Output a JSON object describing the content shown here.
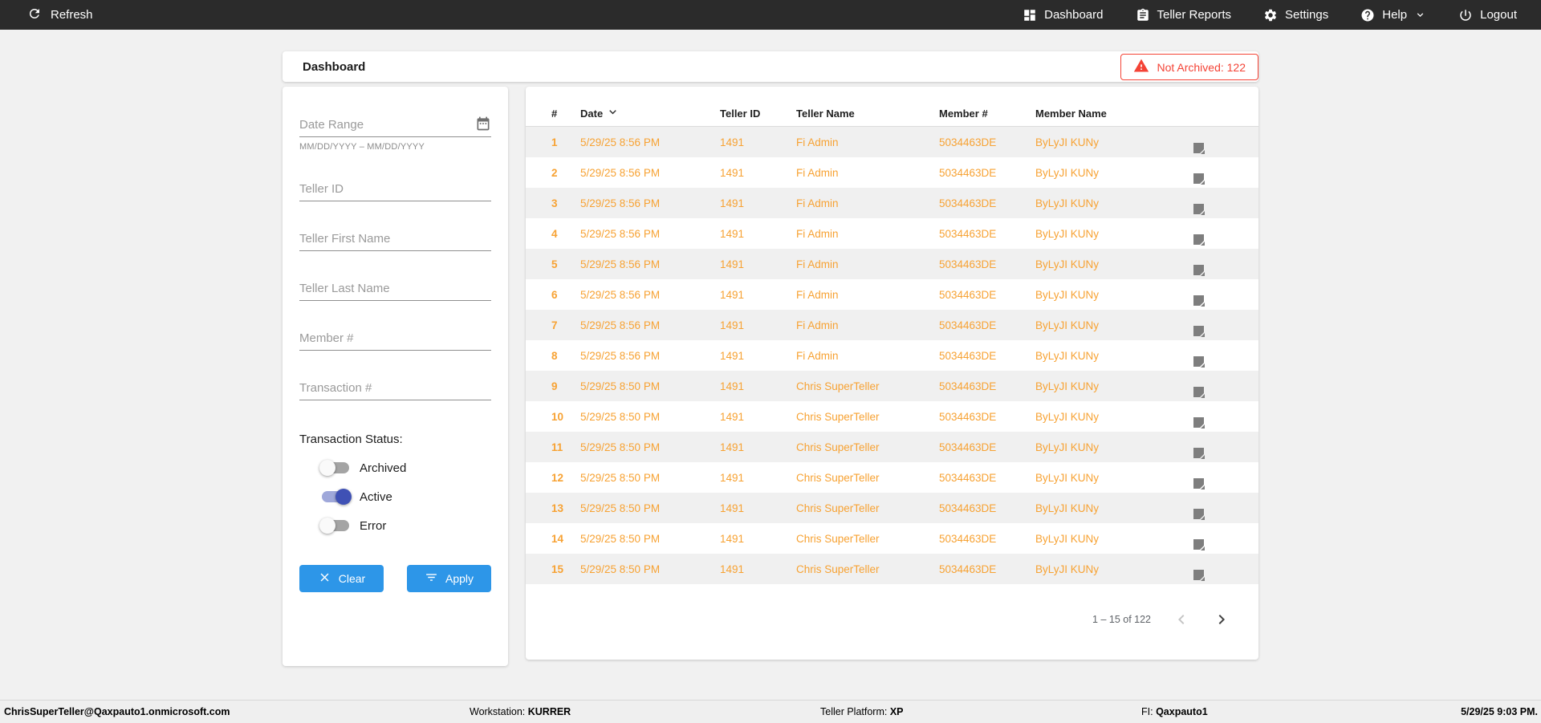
{
  "colors": {
    "navbar_bg": "#2b2b2b",
    "accent_orange": "#f7a233",
    "alert_red": "#f44336",
    "button_blue": "#2d96e8",
    "toggle_on": "#3f51b5",
    "row_stripe": "#f0f0f0"
  },
  "navbar": {
    "refresh_label": "Refresh",
    "items": [
      {
        "label": "Dashboard",
        "icon": "dashboard-icon"
      },
      {
        "label": "Teller Reports",
        "icon": "clipboard-icon"
      },
      {
        "label": "Settings",
        "icon": "gear-icon"
      },
      {
        "label": "Help",
        "icon": "help-icon"
      },
      {
        "label": "Logout",
        "icon": "power-icon"
      }
    ]
  },
  "header": {
    "title": "Dashboard",
    "alert_label": "Not Archived: 122"
  },
  "filters": {
    "date_range": {
      "placeholder": "Date Range",
      "value": "",
      "helper": "MM/DD/YYYY – MM/DD/YYYY"
    },
    "teller_id": {
      "placeholder": "Teller ID",
      "value": ""
    },
    "teller_first_name": {
      "placeholder": "Teller First Name",
      "value": ""
    },
    "teller_last_name": {
      "placeholder": "Teller Last Name",
      "value": ""
    },
    "member_num": {
      "placeholder": "Member #",
      "value": ""
    },
    "transaction_num": {
      "placeholder": "Transaction #",
      "value": ""
    },
    "status": {
      "label": "Transaction Status:",
      "toggles": [
        {
          "label": "Archived",
          "on": false
        },
        {
          "label": "Active",
          "on": true
        },
        {
          "label": "Error",
          "on": false
        }
      ]
    },
    "clear_label": "Clear",
    "apply_label": "Apply"
  },
  "table": {
    "columns": [
      "#",
      "Date",
      "Teller ID",
      "Teller Name",
      "Member #",
      "Member Name"
    ],
    "sorted_column": "Date",
    "rows": [
      {
        "num": "1",
        "date": "5/29/25 8:56 PM",
        "teller_id": "1491",
        "teller_name": "Fi Admin",
        "member_num": "5034463DE",
        "member_name": "ByLyJI KUNy"
      },
      {
        "num": "2",
        "date": "5/29/25 8:56 PM",
        "teller_id": "1491",
        "teller_name": "Fi Admin",
        "member_num": "5034463DE",
        "member_name": "ByLyJI KUNy"
      },
      {
        "num": "3",
        "date": "5/29/25 8:56 PM",
        "teller_id": "1491",
        "teller_name": "Fi Admin",
        "member_num": "5034463DE",
        "member_name": "ByLyJI KUNy"
      },
      {
        "num": "4",
        "date": "5/29/25 8:56 PM",
        "teller_id": "1491",
        "teller_name": "Fi Admin",
        "member_num": "5034463DE",
        "member_name": "ByLyJI KUNy"
      },
      {
        "num": "5",
        "date": "5/29/25 8:56 PM",
        "teller_id": "1491",
        "teller_name": "Fi Admin",
        "member_num": "5034463DE",
        "member_name": "ByLyJI KUNy"
      },
      {
        "num": "6",
        "date": "5/29/25 8:56 PM",
        "teller_id": "1491",
        "teller_name": "Fi Admin",
        "member_num": "5034463DE",
        "member_name": "ByLyJI KUNy"
      },
      {
        "num": "7",
        "date": "5/29/25 8:56 PM",
        "teller_id": "1491",
        "teller_name": "Fi Admin",
        "member_num": "5034463DE",
        "member_name": "ByLyJI KUNy"
      },
      {
        "num": "8",
        "date": "5/29/25 8:56 PM",
        "teller_id": "1491",
        "teller_name": "Fi Admin",
        "member_num": "5034463DE",
        "member_name": "ByLyJI KUNy"
      },
      {
        "num": "9",
        "date": "5/29/25 8:50 PM",
        "teller_id": "1491",
        "teller_name": "Chris SuperTeller",
        "member_num": "5034463DE",
        "member_name": "ByLyJI KUNy"
      },
      {
        "num": "10",
        "date": "5/29/25 8:50 PM",
        "teller_id": "1491",
        "teller_name": "Chris SuperTeller",
        "member_num": "5034463DE",
        "member_name": "ByLyJI KUNy"
      },
      {
        "num": "11",
        "date": "5/29/25 8:50 PM",
        "teller_id": "1491",
        "teller_name": "Chris SuperTeller",
        "member_num": "5034463DE",
        "member_name": "ByLyJI KUNy"
      },
      {
        "num": "12",
        "date": "5/29/25 8:50 PM",
        "teller_id": "1491",
        "teller_name": "Chris SuperTeller",
        "member_num": "5034463DE",
        "member_name": "ByLyJI KUNy"
      },
      {
        "num": "13",
        "date": "5/29/25 8:50 PM",
        "teller_id": "1491",
        "teller_name": "Chris SuperTeller",
        "member_num": "5034463DE",
        "member_name": "ByLyJI KUNy"
      },
      {
        "num": "14",
        "date": "5/29/25 8:50 PM",
        "teller_id": "1491",
        "teller_name": "Chris SuperTeller",
        "member_num": "5034463DE",
        "member_name": "ByLyJI KUNy"
      },
      {
        "num": "15",
        "date": "5/29/25 8:50 PM",
        "teller_id": "1491",
        "teller_name": "Chris SuperTeller",
        "member_num": "5034463DE",
        "member_name": "ByLyJI KUNy"
      }
    ],
    "pagination": {
      "range_label": "1 – 15 of 122"
    }
  },
  "footer": {
    "user": "ChrisSuperTeller@Qaxpauto1.onmicrosoft.com",
    "workstation_label": "Workstation:",
    "workstation": "KURRER",
    "platform_label": "Teller Platform:",
    "platform": "XP",
    "fi_label": "FI:",
    "fi": "Qaxpauto1",
    "datetime": "5/29/25 9:03 PM."
  }
}
